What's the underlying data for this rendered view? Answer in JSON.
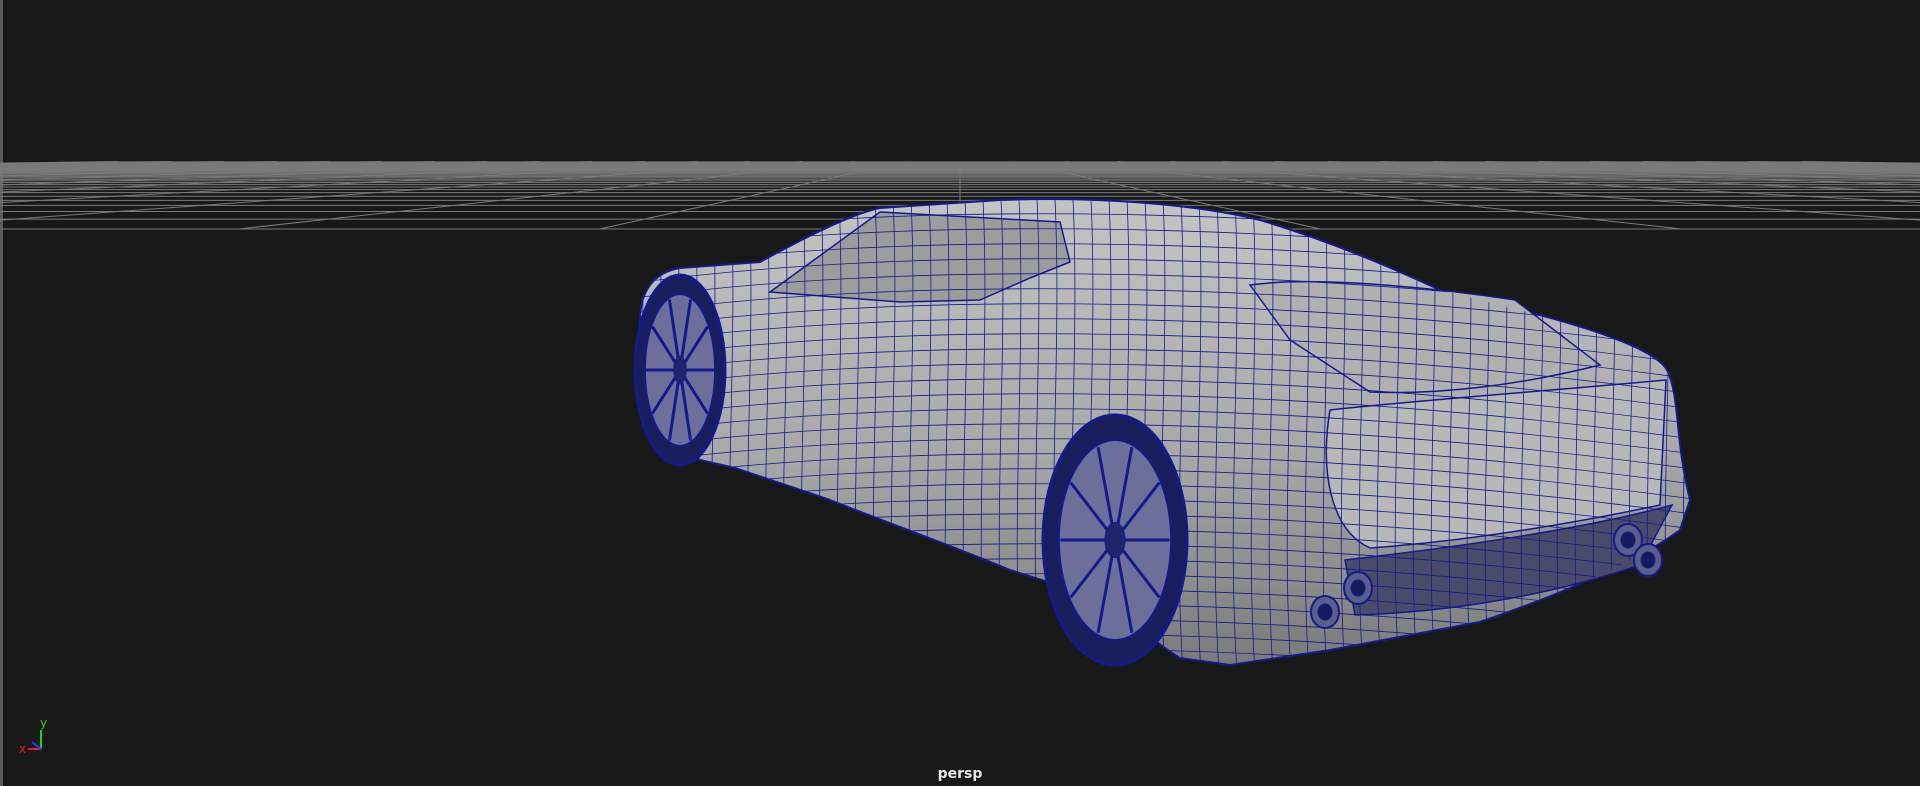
{
  "viewport": {
    "camera_label": "persp",
    "background_color": "#181818",
    "grid_color": "#7a7a7a",
    "wire_color": "#141a8c",
    "shade_color": "#a8a8a8"
  },
  "axis_gizmo": {
    "x_label": "x",
    "y_label": "y",
    "x_color": "#e02020",
    "y_color": "#20d020",
    "z_color": "#2040ff"
  },
  "model": {
    "icon": "car-wireframe"
  }
}
